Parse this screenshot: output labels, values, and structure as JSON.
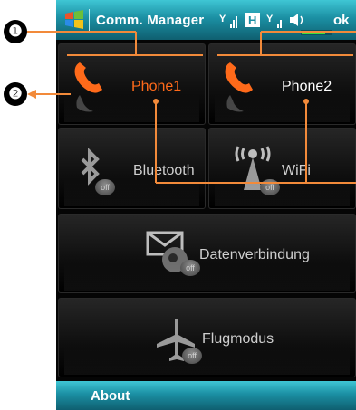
{
  "titlebar": {
    "app_title": "Comm. Manager",
    "ok_label": "ok",
    "icons": [
      "windows-start-icon",
      "signal-icon",
      "h-network-icon",
      "signal2-icon",
      "volume-icon",
      "battery-icon"
    ]
  },
  "tiles": [
    {
      "label": "Phone1",
      "icon": "phone-icon",
      "state": "on",
      "label_color": "#ff6a1a"
    },
    {
      "label": "Phone2",
      "icon": "phone-icon",
      "state": "on",
      "label_color": "#ffffff"
    },
    {
      "label": "Bluetooth",
      "icon": "bluetooth-icon",
      "state": "off",
      "badge": "off"
    },
    {
      "label": "WiFi",
      "icon": "wifi-icon",
      "state": "off",
      "badge": "off"
    },
    {
      "label": "Datenverbindung",
      "icon": "data-connection-icon",
      "state": "off",
      "badge": "off"
    },
    {
      "label": "Flugmodus",
      "icon": "airplane-icon",
      "state": "off",
      "badge": "off"
    }
  ],
  "bottombar": {
    "about_label": "About"
  },
  "callouts": [
    "❶",
    "❷"
  ]
}
